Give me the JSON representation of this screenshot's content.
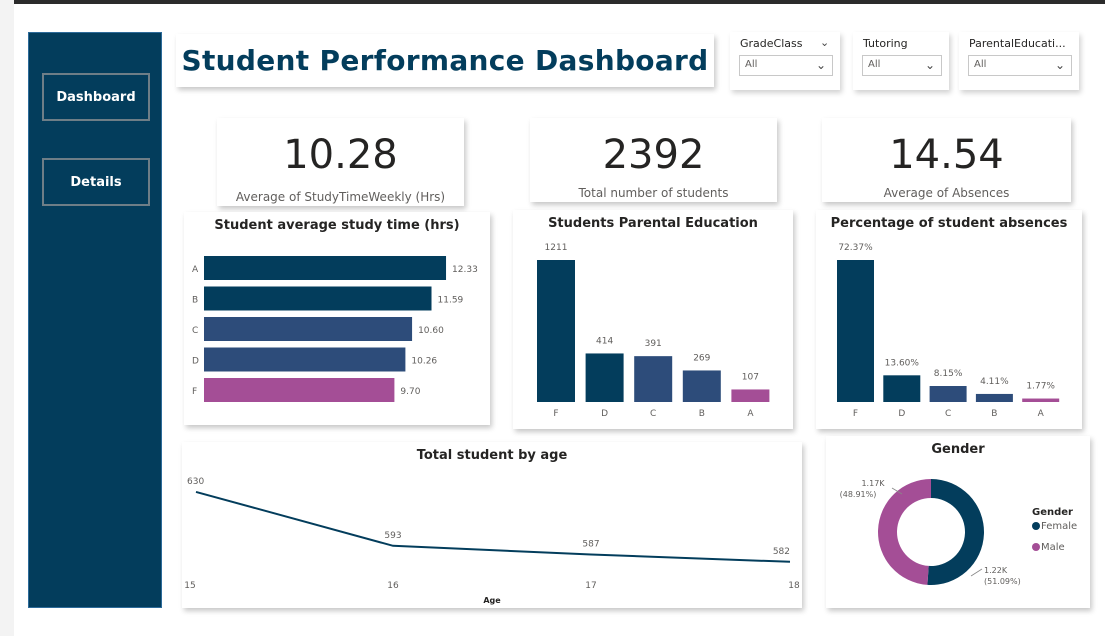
{
  "sidebar": {
    "items": [
      {
        "label": "Dashboard"
      },
      {
        "label": "Details"
      }
    ]
  },
  "header": {
    "title": "Student Performance Dashboard"
  },
  "slicers": [
    {
      "label": "GradeClass",
      "value": "All"
    },
    {
      "label": "Tutoring",
      "value": "All"
    },
    {
      "label": "ParentalEducati...",
      "value": "All"
    }
  ],
  "kpis": [
    {
      "value": "10.28",
      "label": "Average of StudyTimeWeekly (Hrs)"
    },
    {
      "value": "2392",
      "label": "Total number of students"
    },
    {
      "value": "14.54",
      "label": "Average of Absences"
    }
  ],
  "colors": {
    "dark": "#033d5c",
    "mid": "#2d4c7a",
    "purple": "#a44e96",
    "sidebar": "#033d5c"
  },
  "chart_data": [
    {
      "id": "study",
      "type": "bar",
      "orientation": "horizontal",
      "title": "Student average study time (hrs)",
      "categories": [
        "A",
        "B",
        "C",
        "D",
        "F"
      ],
      "values": [
        12.33,
        11.59,
        10.6,
        10.26,
        9.7
      ],
      "labels": [
        "12.33",
        "11.59",
        "10.60",
        "10.26",
        "9.70"
      ],
      "xlim": [
        0,
        13.5
      ]
    },
    {
      "id": "parent",
      "type": "bar",
      "title": "Students Parental Education",
      "categories": [
        "F",
        "D",
        "C",
        "B",
        "A"
      ],
      "values": [
        1211,
        414,
        391,
        269,
        107
      ],
      "labels": [
        "1211",
        "414",
        "391",
        "269",
        "107"
      ],
      "ylim": [
        0,
        1211
      ]
    },
    {
      "id": "absence",
      "type": "bar",
      "title": "Percentage of student absences",
      "categories": [
        "F",
        "D",
        "C",
        "B",
        "A"
      ],
      "values": [
        72.37,
        13.6,
        8.15,
        4.11,
        1.77
      ],
      "labels": [
        "72.37%",
        "13.60%",
        "8.15%",
        "4.11%",
        "1.77%"
      ],
      "ylim": [
        0,
        72.37
      ]
    },
    {
      "id": "age",
      "type": "line",
      "title": "Total student by age",
      "xlabel": "Age",
      "x": [
        "15",
        "16",
        "17",
        "18"
      ],
      "values": [
        630,
        593,
        587,
        582
      ],
      "ylim": [
        575,
        632
      ]
    },
    {
      "id": "gender",
      "type": "pie",
      "donut": true,
      "title": "Gender",
      "legend_title": "Gender",
      "legend_position": "right",
      "slices": [
        {
          "name": "Female",
          "value": 1222,
          "label": "1.22K",
          "pct": "(51.09%)"
        },
        {
          "name": "Male",
          "value": 1170,
          "label": "1.17K",
          "pct": "(48.91%)"
        }
      ]
    }
  ]
}
